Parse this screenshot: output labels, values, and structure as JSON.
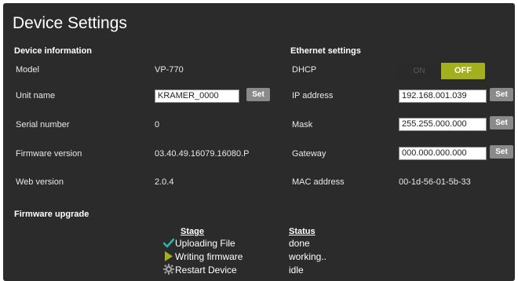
{
  "title": "Device Settings",
  "device_info": {
    "heading": "Device information",
    "model_label": "Model",
    "model_value": "VP-770",
    "unit_name_label": "Unit name",
    "unit_name_value": "KRAMER_0000",
    "unit_name_set": "Set",
    "serial_label": "Serial number",
    "serial_value": "0",
    "firmware_label": "Firmware version",
    "firmware_value": "03.40.49.16079.16080.P",
    "web_label": "Web version",
    "web_value": "2.0.4"
  },
  "ethernet": {
    "heading": "Ethernet settings",
    "dhcp_label": "DHCP",
    "dhcp_on": "ON",
    "dhcp_off": "OFF",
    "dhcp_state": "OFF",
    "ip_label": "IP address",
    "ip_value": "192.168.001.039",
    "ip_set": "Set",
    "mask_label": "Mask",
    "mask_value": "255.255.000.000",
    "mask_set": "Set",
    "gateway_label": "Gateway",
    "gateway_value": "000.000.000.000",
    "gateway_set": "Set",
    "mac_label": "MAC address",
    "mac_value": "00-1d-56-01-5b-33"
  },
  "firmware_upgrade": {
    "heading": "Firmware upgrade",
    "stage_header": "Stage",
    "status_header": "Status",
    "stages": [
      {
        "icon": "check-icon",
        "stage": "Uploading File",
        "status": "done"
      },
      {
        "icon": "play-icon",
        "stage": "Writing firmware",
        "status": "working.."
      },
      {
        "icon": "gear-icon",
        "stage": "Restart Device",
        "status": "idle"
      }
    ]
  },
  "colors": {
    "background": "#2b2b2b",
    "accent_green": "#a2b01d",
    "check_green": "#2fb6a0",
    "button_gray": "#8a8a8a"
  }
}
